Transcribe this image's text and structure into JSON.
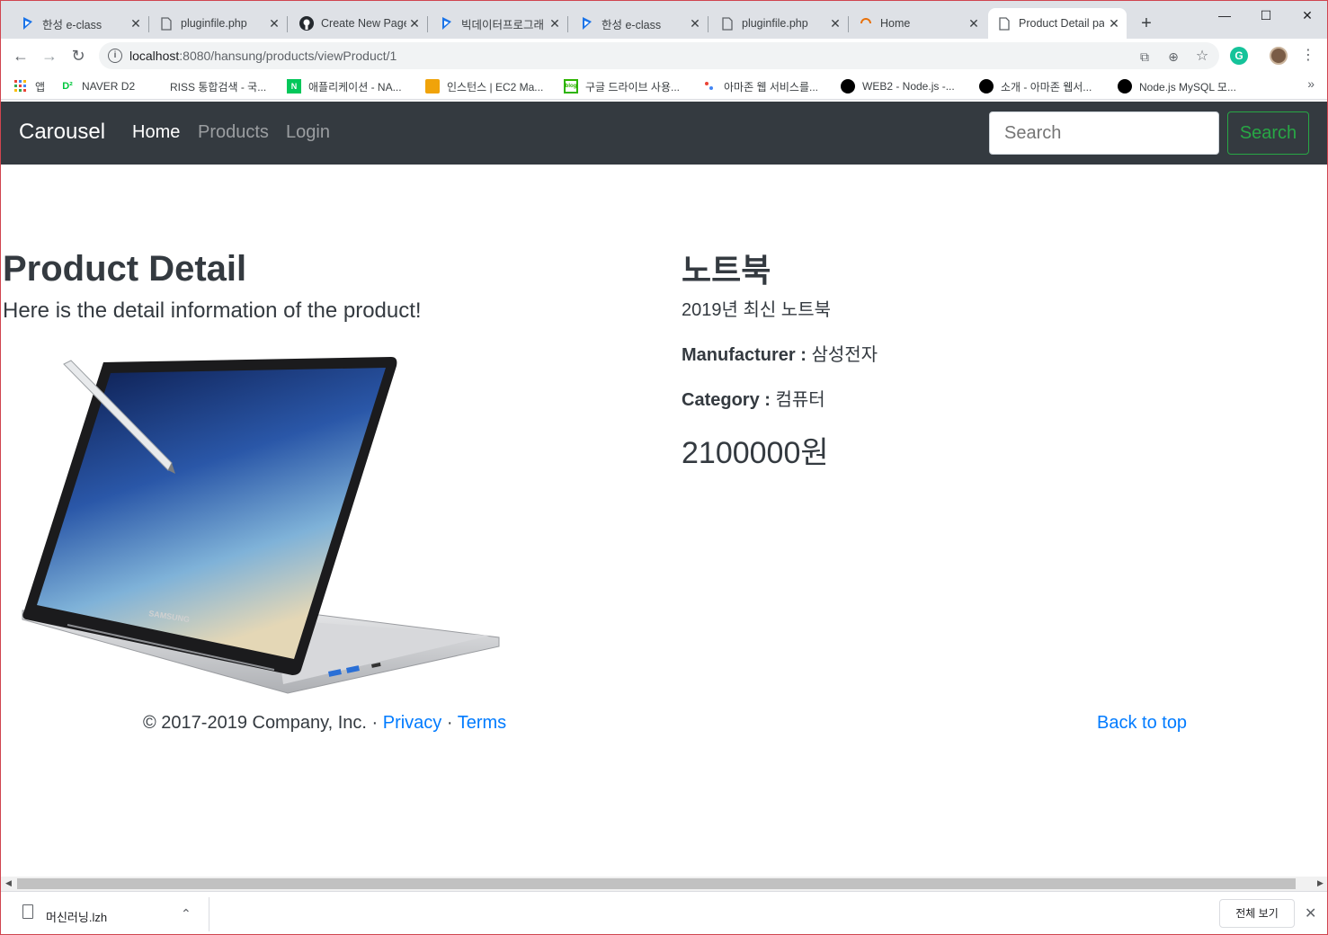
{
  "browser": {
    "tabs": [
      {
        "title": "한성 e-class",
        "icon": "eclass-icon"
      },
      {
        "title": "pluginfile.php",
        "icon": "page-icon"
      },
      {
        "title": "Create New Page",
        "icon": "github-icon"
      },
      {
        "title": "빅데이터프로그래",
        "icon": "eclass-icon"
      },
      {
        "title": "한성 e-class",
        "icon": "eclass-icon"
      },
      {
        "title": "pluginfile.php",
        "icon": "page-icon"
      },
      {
        "title": "Home",
        "icon": "loading-icon"
      },
      {
        "title": "Product Detail pa",
        "icon": "page-icon",
        "active": true
      }
    ],
    "url_host": "localhost",
    "url_rest": ":8080/hansung/products/viewProduct/1",
    "bookmarks": [
      {
        "label": "앱",
        "icon": "apps-icon"
      },
      {
        "label": "NAVER D2",
        "icon": "d2-icon"
      },
      {
        "label": "RISS 통합검색 - 국...",
        "icon": "riss-icon"
      },
      {
        "label": "애플리케이션 - NA...",
        "icon": "naver-icon"
      },
      {
        "label": "인스턴스 | EC2 Ma...",
        "icon": "aws-icon"
      },
      {
        "label": "구글 드라이브 사용...",
        "icon": "blog-icon"
      },
      {
        "label": "아마존 웹 서비스를...",
        "icon": "dots-icon"
      },
      {
        "label": "WEB2 - Node.js -...",
        "icon": "circle-icon"
      },
      {
        "label": "소개 - 아마존 웹서...",
        "icon": "circle-icon"
      },
      {
        "label": "Node.js MySQL 모...",
        "icon": "circle-icon"
      }
    ],
    "bookmarks_more": "»"
  },
  "navbar": {
    "brand": "Carousel",
    "links": [
      "Home",
      "Products",
      "Login"
    ],
    "search_placeholder": "Search",
    "search_button": "Search"
  },
  "page": {
    "title": "Product Detail",
    "lead": "Here is the detail information of the product!",
    "image_brand": "SAMSUNG"
  },
  "product": {
    "name": "노트북",
    "description": "2019년 최신 노트북",
    "manufacturer_label": "Manufacturer : ",
    "manufacturer": "삼성전자",
    "category_label": "Category : ",
    "category": "컴퓨터",
    "price": "2100000원"
  },
  "footer": {
    "copyright": "© 2017-2019 Company, Inc. · ",
    "privacy": "Privacy",
    "dot": " · ",
    "terms": "Terms",
    "back_to_top": "Back to top"
  },
  "download_bar": {
    "file_name": "머신러닝.lzh",
    "show_all": "전체 보기"
  },
  "colors": {
    "navbar_bg": "#343a40",
    "success": "#28a745",
    "link": "#007bff"
  }
}
